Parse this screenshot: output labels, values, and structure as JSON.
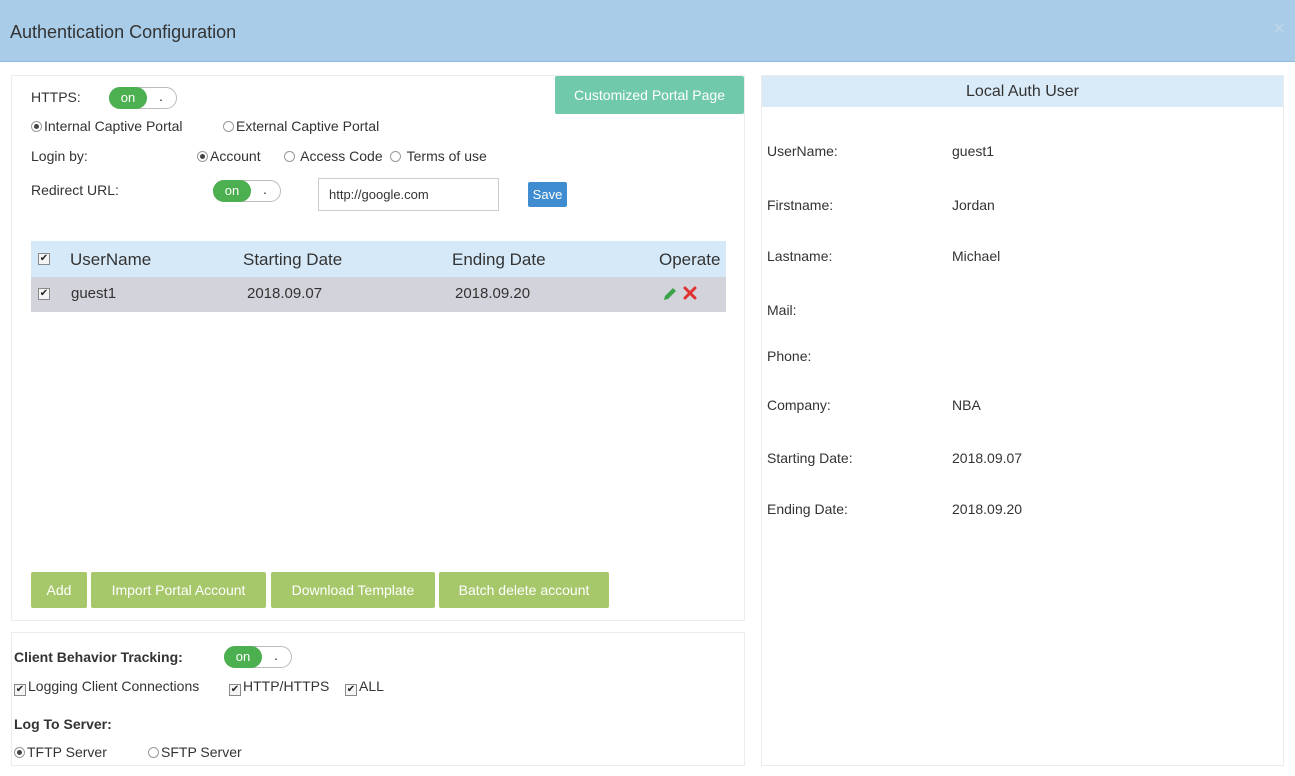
{
  "window": {
    "title": "Authentication Configuration",
    "close": "×"
  },
  "portal": {
    "https_label": "HTTPS:",
    "toggle_on": "on",
    "toggle_knob": ".",
    "customized_button": "Customized Portal Page",
    "internal_portal": "Internal Captive Portal",
    "external_portal": "External Captive Portal",
    "login_by_label": "Login by:",
    "login_account": "Account",
    "login_access_code": "Access Code",
    "login_terms": "Terms of use",
    "redirect_label": "Redirect URL:",
    "redirect_value": "http://google.com",
    "save_button": "Save"
  },
  "table": {
    "headers": {
      "username": "UserName",
      "start": "Starting Date",
      "end": "Ending Date",
      "operate": "Operate"
    },
    "rows": [
      {
        "username": "guest1",
        "start": "2018.09.07",
        "end": "2018.09.20"
      }
    ]
  },
  "actions": {
    "add": "Add",
    "import": "Import Portal Account",
    "download": "Download Template",
    "batch_delete": "Batch delete account"
  },
  "tracking": {
    "label": "Client Behavior Tracking:",
    "logging": "Logging Client Connections",
    "http": "HTTP/HTTPS",
    "all": "ALL",
    "log_to_server": "Log To Server:",
    "tftp": "TFTP Server",
    "sftp": "SFTP Server"
  },
  "detail": {
    "header": "Local Auth User",
    "username_label": "UserName:",
    "username": "guest1",
    "firstname_label": "Firstname:",
    "firstname": "Jordan",
    "lastname_label": "Lastname:",
    "lastname": "Michael",
    "mail_label": "Mail:",
    "phone_label": "Phone:",
    "company_label": "Company:",
    "company": "NBA",
    "start_label": "Starting Date:",
    "start": "2018.09.07",
    "end_label": "Ending Date:",
    "end": "2018.09.20"
  }
}
